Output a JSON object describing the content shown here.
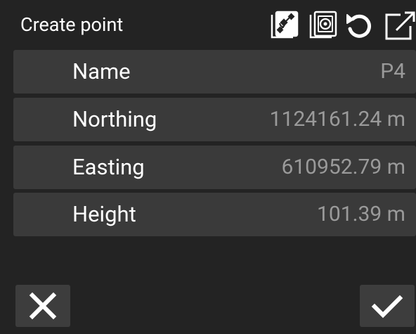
{
  "header": {
    "title": "Create point",
    "icons": [
      "satellite-icon",
      "target-icon",
      "undo-icon",
      "external-link-icon"
    ]
  },
  "fields": [
    {
      "label": "Name",
      "value": "P4"
    },
    {
      "label": "Northing",
      "value": "1124161.24 m"
    },
    {
      "label": "Easting",
      "value": "610952.79 m"
    },
    {
      "label": "Height",
      "value": "101.39 m"
    }
  ],
  "footer": {
    "cancel_icon": "close-icon",
    "confirm_icon": "check-icon"
  },
  "colors": {
    "background": "#232323",
    "row_background": "#3a3a3a",
    "value_text": "#9a9a9a"
  }
}
